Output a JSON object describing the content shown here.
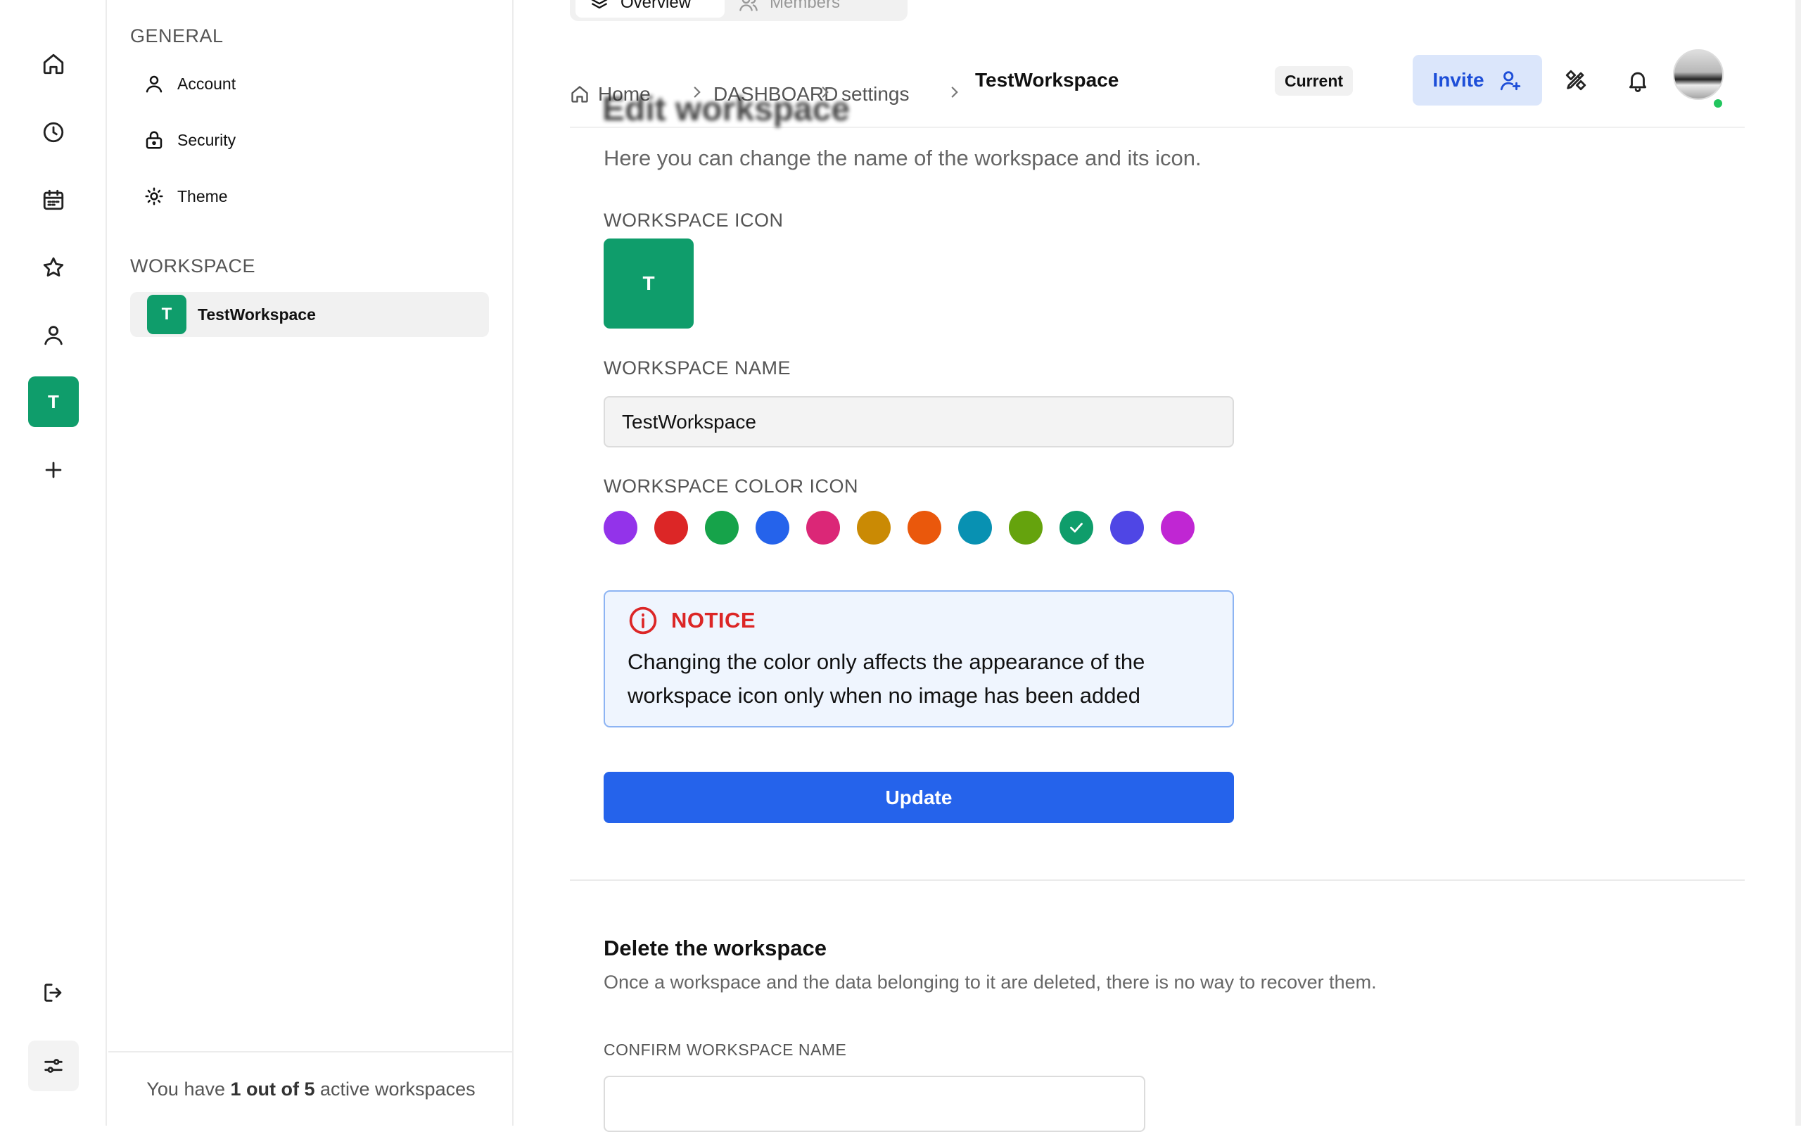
{
  "rail": {
    "workspace_initial": "T"
  },
  "sidenav": {
    "general_heading": "GENERAL",
    "items": [
      {
        "label": "Account"
      },
      {
        "label": "Security"
      },
      {
        "label": "Theme"
      }
    ],
    "workspace_heading": "WORKSPACE",
    "workspace": {
      "initial": "T",
      "name": "TestWorkspace"
    },
    "footer": {
      "prefix": "You have ",
      "count": "1 out of 5",
      "suffix": " active workspaces"
    }
  },
  "tabs": [
    {
      "label": "Overview",
      "icon": "layers-icon",
      "active": true
    },
    {
      "label": "Members",
      "icon": "users-icon",
      "active": false
    }
  ],
  "breadcrumb": {
    "home": "Home",
    "dashboard": "DASHBOARD",
    "settings": "settings",
    "current": "TestWorkspace",
    "badge": "Current"
  },
  "header": {
    "invite_label": "Invite"
  },
  "edit": {
    "title": "Edit workspace",
    "subtitle": "Here you can change the name of the workspace and its icon.",
    "icon_label": "WORKSPACE ICON",
    "icon_initial": "T",
    "name_label": "WORKSPACE NAME",
    "name_value": "TestWorkspace",
    "color_label": "WORKSPACE COLOR ICON",
    "colors": [
      "#9333ea",
      "#dc2626",
      "#16a34a",
      "#2563eb",
      "#db2777",
      "#ca8a04",
      "#ea580c",
      "#0891b2",
      "#65a30d",
      "#0f9d6b",
      "#4f46e5",
      "#c026d3"
    ],
    "selected_color_index": 9,
    "notice_title": "NOTICE",
    "notice_line1": "Changing the color only affects the appearance of the",
    "notice_line2": "workspace icon only when no image has been added",
    "update_label": "Update"
  },
  "delete": {
    "title": "Delete the workspace",
    "subtitle": "Once a workspace and the data belonging to it are deleted, there is no way to recover them.",
    "confirm_label": "CONFIRM WORKSPACE NAME",
    "confirm_value": ""
  },
  "colors": {
    "accent": "#2563eb",
    "workspace": "#0f9d6b",
    "notice": "#dc2626",
    "online": "#22c55e"
  }
}
